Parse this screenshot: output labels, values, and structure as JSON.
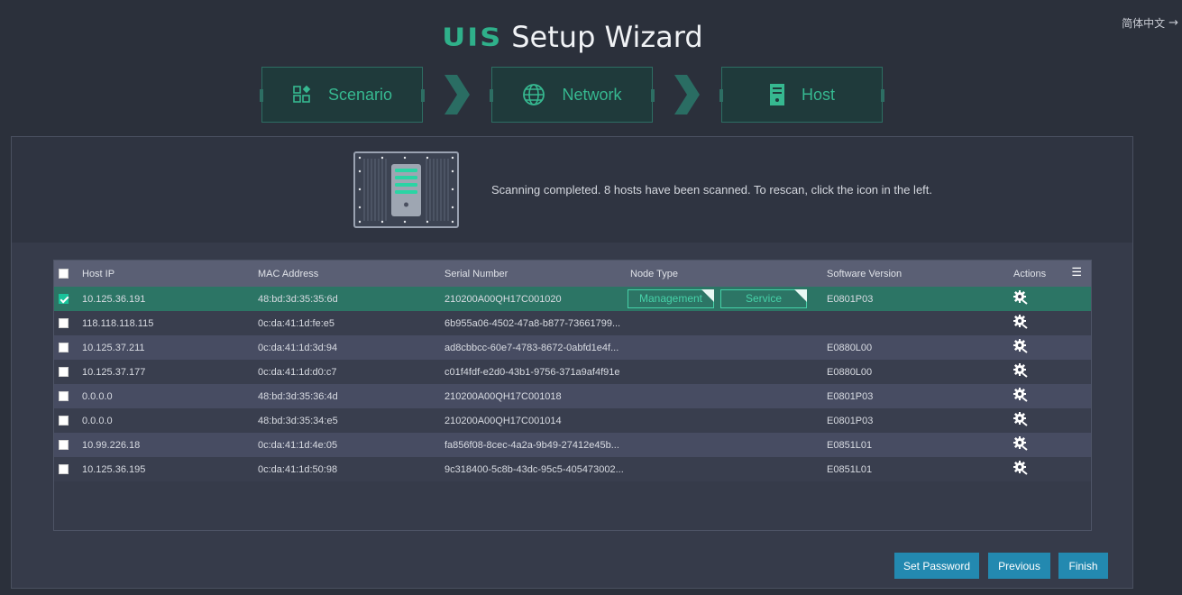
{
  "header": {
    "language": "简体中文",
    "logo_text": "UIS",
    "title": "Setup Wizard"
  },
  "steps": [
    {
      "label": "Scenario",
      "icon": "scenario-icon"
    },
    {
      "label": "Network",
      "icon": "globe-icon"
    },
    {
      "label": "Host",
      "icon": "server-icon"
    }
  ],
  "scan": {
    "message": "Scanning completed. 8 hosts have been scanned. To rescan, click the icon in the left."
  },
  "table": {
    "columns": [
      "Host IP",
      "MAC Address",
      "Serial Number",
      "Node Type",
      "Software Version",
      "Actions"
    ],
    "rows": [
      {
        "ip": "10.125.36.191",
        "mac": "48:bd:3d:35:35:6d",
        "serial": "210200A00QH17C001020",
        "version": "E0801P03",
        "checked": true,
        "node_types": [
          "Management",
          "Service"
        ]
      },
      {
        "ip": "118.118.118.115",
        "mac": "0c:da:41:1d:fe:e5",
        "serial": "6b955a06-4502-47a8-b877-73661799...",
        "version": "",
        "checked": false
      },
      {
        "ip": "10.125.37.211",
        "mac": "0c:da:41:1d:3d:94",
        "serial": "ad8cbbcc-60e7-4783-8672-0abfd1e4f...",
        "version": "E0880L00",
        "checked": false
      },
      {
        "ip": "10.125.37.177",
        "mac": "0c:da:41:1d:d0:c7",
        "serial": "c01f4fdf-e2d0-43b1-9756-371a9af4f91e",
        "version": "E0880L00",
        "checked": false
      },
      {
        "ip": "0.0.0.0",
        "mac": "48:bd:3d:35:36:4d",
        "serial": "210200A00QH17C001018",
        "version": "E0801P03",
        "checked": false
      },
      {
        "ip": "0.0.0.0",
        "mac": "48:bd:3d:35:34:e5",
        "serial": "210200A00QH17C001014",
        "version": "E0801P03",
        "checked": false
      },
      {
        "ip": "10.99.226.18",
        "mac": "0c:da:41:1d:4e:05",
        "serial": "fa856f08-8cec-4a2a-9b49-27412e45b...",
        "version": "E0851L01",
        "checked": false
      },
      {
        "ip": "10.125.36.195",
        "mac": "0c:da:41:1d:50:98",
        "serial": "9c318400-5c8b-43dc-95c5-405473002...",
        "version": "E0851L01",
        "checked": false
      }
    ]
  },
  "buttons": {
    "set_password": "Set Password",
    "previous": "Previous",
    "finish": "Finish"
  },
  "colors": {
    "accent_green": "#36b890",
    "selected_row": "#2c7565",
    "button_blue": "#2389b0"
  }
}
